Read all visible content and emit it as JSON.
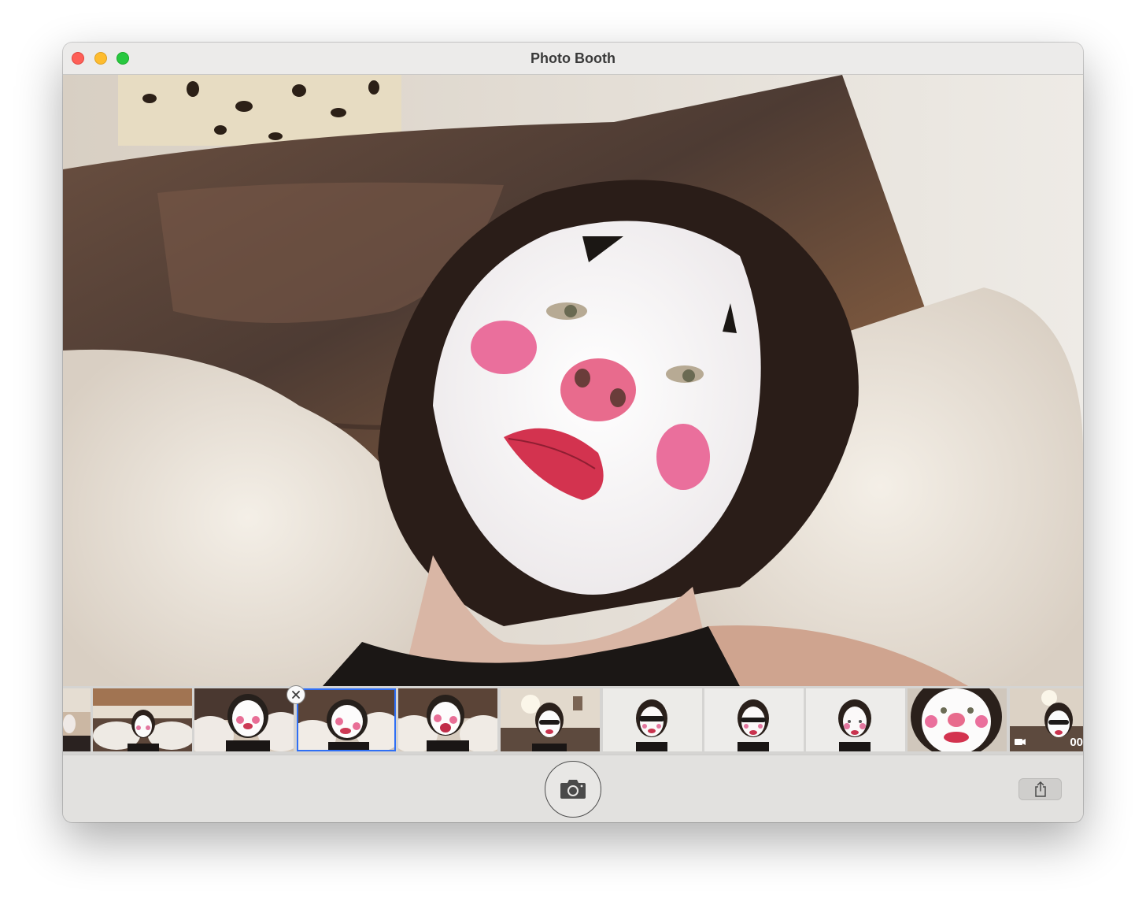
{
  "window": {
    "title": "Photo Booth"
  },
  "filmstrip": {
    "selected_index": 3,
    "thumbnails": [
      {
        "kind": "photo",
        "scene": "partial"
      },
      {
        "kind": "photo",
        "scene": "room-couch"
      },
      {
        "kind": "photo",
        "scene": "fur-closeup"
      },
      {
        "kind": "photo",
        "scene": "fur-lying"
      },
      {
        "kind": "photo",
        "scene": "fur-mouth-open"
      },
      {
        "kind": "photo",
        "scene": "room-sunglasses"
      },
      {
        "kind": "photo",
        "scene": "white-sunglasses"
      },
      {
        "kind": "photo",
        "scene": "white-sunglasses-2"
      },
      {
        "kind": "photo",
        "scene": "white-plain"
      },
      {
        "kind": "photo",
        "scene": "face-closeup"
      },
      {
        "kind": "video",
        "scene": "room-sunglasses-video",
        "duration_text": "00"
      }
    ]
  },
  "toolbar": {
    "capture_icon": "camera-icon",
    "share_icon": "share-icon"
  }
}
